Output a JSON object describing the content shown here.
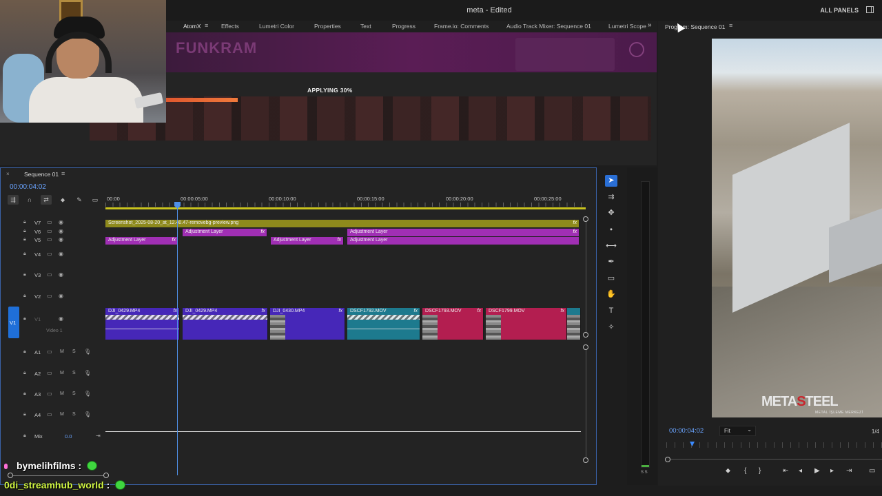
{
  "window": {
    "title": "meta - Edited",
    "all_panels": "ALL PANELS"
  },
  "tabs": [
    {
      "label": "AtomX",
      "active": true
    },
    {
      "label": "Effects"
    },
    {
      "label": "Lumetri Color"
    },
    {
      "label": "Properties"
    },
    {
      "label": "Text"
    },
    {
      "label": "Progress"
    },
    {
      "label": "Frame.io: Comments"
    },
    {
      "label": "Audio Track Mixer: Sequence 01"
    },
    {
      "label": "Lumetri Scope"
    }
  ],
  "banner": {
    "logo": "FUNKRAM"
  },
  "applying": {
    "label": "APPLYING 30%",
    "progress": 0.3
  },
  "program": {
    "title": "Program: Sequence 01",
    "timecode": "00:00:04:02",
    "fit": "Fit",
    "zoom": "1/4",
    "watermark_main": "METASTEEL",
    "watermark_sub": "METAL İŞLEME MERKEZİ"
  },
  "timeline": {
    "tab": "Sequence 01",
    "timecode": "00:00:04:02",
    "ruler": [
      "00:00",
      "00:00:05:00",
      "00:00:10:00",
      "00:00:15:00",
      "00:00:20:00",
      "00:00:25:00"
    ],
    "tracks_video": [
      "V7",
      "V6",
      "V5",
      "V4",
      "V3",
      "V2",
      "V1"
    ],
    "video1_label": "Video 1",
    "tracks_audio": [
      "A1",
      "A2",
      "A3",
      "A4"
    ],
    "mix_label": "Mix",
    "mix_value": "0.0",
    "clips": {
      "v7": "Screenshot_2025-08-20_at_12.40.47-removebg-preview.png",
      "v6a": "Adjustment Layer",
      "v6b": "Adjustment Layer",
      "v5a": "Adjustment Layer",
      "v5b": "Adjustment Layer",
      "v5c": "Adjustment Layer",
      "v1a": "DJI_0429.MP4",
      "v1b": "DJI_0429.MP4",
      "v1c": "DJI_0430.MP4",
      "v1d": "DSCF1792.MOV",
      "v1e": "DSCF1793.MOV",
      "v1f": "DSCF1799.MOV"
    },
    "track_letters": {
      "m": "M",
      "s": "S"
    },
    "fx": "fx"
  },
  "chat": [
    {
      "name": "bymelihfilms",
      "sep": ":"
    },
    {
      "name": "0di_streamhub_world",
      "sep": ":"
    }
  ],
  "colors": {
    "accent": "#6aa4ff",
    "adjustment": "#a02fb4",
    "progress": "#f07a3c"
  }
}
